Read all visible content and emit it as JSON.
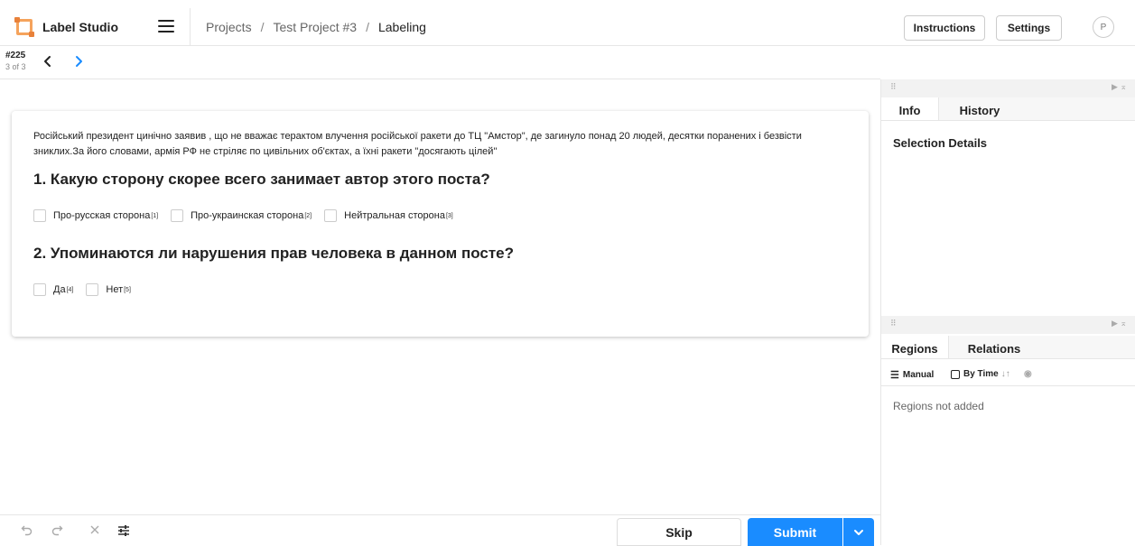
{
  "app": {
    "name": "Label Studio"
  },
  "breadcrumb": [
    {
      "label": "Projects"
    },
    {
      "label": "Test Project #3"
    },
    {
      "label": "Labeling"
    }
  ],
  "breadcrumb_sep": "/",
  "header_buttons": {
    "instructions": "Instructions",
    "settings": "Settings"
  },
  "user": {
    "initial": "P"
  },
  "task": {
    "id": "#225",
    "position": "3 of 3"
  },
  "post_text": "Російський президент цинічно заявив , що не вважає терактом влучення російської ракети до ТЦ \"Амстор\", де загинуло понад 20 людей, десятки поранених і безвісти зниклих.За його словами, армія РФ не стріляє по цивільних об'єктах, а їхні ракети \"досягають цілей\"",
  "questions": [
    {
      "title": "1. Какую сторону скорее всего занимает автор этого поста?",
      "choices": [
        {
          "label": "Про-русская сторона",
          "hotkey": "[1]"
        },
        {
          "label": "Про-украинская сторона",
          "hotkey": "[2]"
        },
        {
          "label": "Нейтральная сторона",
          "hotkey": "[3]"
        }
      ]
    },
    {
      "title": "2. Упоминаются ли нарушения прав человека в данном посте?",
      "choices": [
        {
          "label": "Да",
          "hotkey": "[4]"
        },
        {
          "label": "Нет",
          "hotkey": "[5]"
        }
      ]
    }
  ],
  "actions": {
    "skip": "Skip",
    "submit": "Submit"
  },
  "side_panel_top": {
    "tabs": [
      "Info",
      "History"
    ],
    "active_tab": "Info",
    "section_title": "Selection Details"
  },
  "side_panel_bottom": {
    "tabs": [
      "Regions",
      "Relations"
    ],
    "active_tab": "Regions",
    "sort_manual": "Manual",
    "sort_by_time": "By Time",
    "empty_text": "Regions not added"
  },
  "colors": {
    "accent": "#1a8cff",
    "logo": "#f5a35c"
  }
}
